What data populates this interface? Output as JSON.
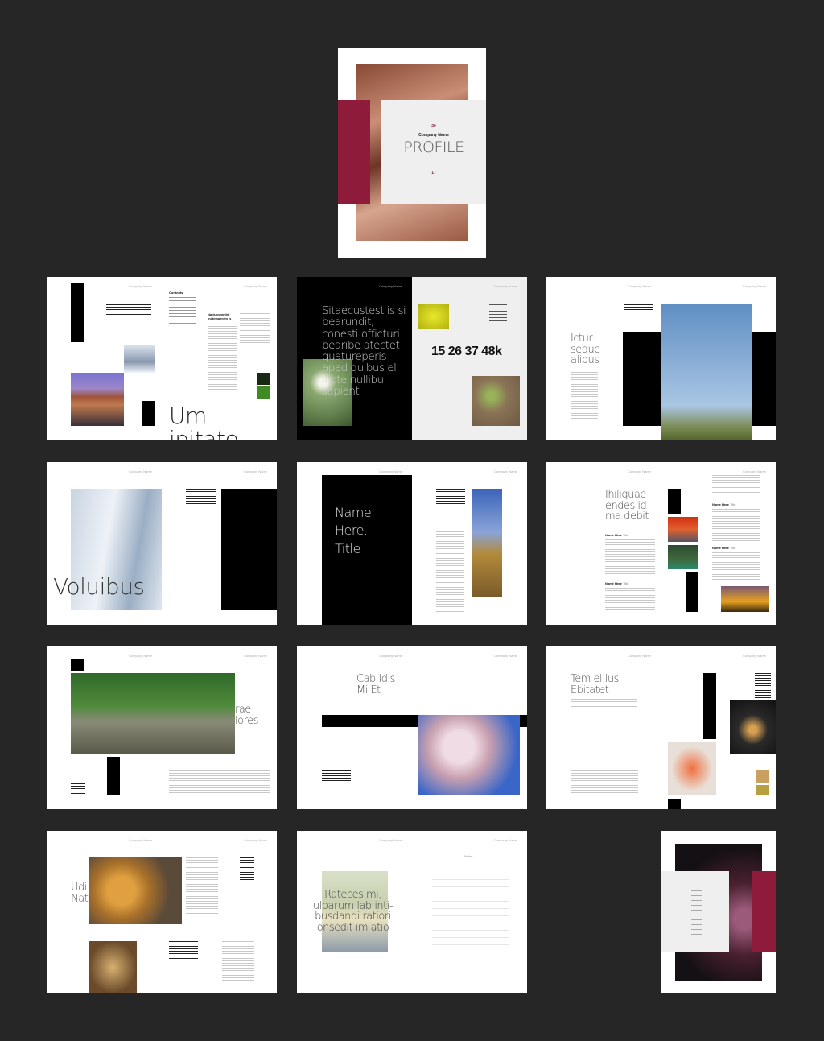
{
  "colors": {
    "background": "#262626",
    "accent": "#8e1b3a",
    "panel": "#efefef"
  },
  "header": "Company Name",
  "cover": {
    "year_top": "20",
    "company": "Company Name",
    "title": "PROFILE",
    "year_bottom": "17"
  },
  "spread1": {
    "contents": "Contents",
    "subtitle": "Natis comnihil inctemperem is",
    "display": "Um ipitate"
  },
  "spread2": {
    "quote": "Sitaecustest is si bearundit, conesti officturi bearibe atectet quatureperis aped quibus el incte nullibu sapient",
    "stats": "15 26 37 48k"
  },
  "spread3": {
    "display": "Ictur seque alibus"
  },
  "spread4": {
    "display": "Voluibus"
  },
  "spread5": {
    "display": "Name Here. Title"
  },
  "spread6": {
    "display": "Ihiliquae endes id ma debit",
    "name1": "Name Here",
    "title1": "Title",
    "name2": "Name Here",
    "title2": "Title",
    "name3": "Name Here",
    "title3": "Title",
    "name4": "Name Here",
    "title4": "Title"
  },
  "spread7": {
    "display": "rae lores"
  },
  "spread8": {
    "display": "Cab Idis Mi Et"
  },
  "spread9": {
    "display": "Tem el lus Ebitatet"
  },
  "spread10": {
    "display": "Udi Nati"
  },
  "spread11": {
    "display": "Rateces mi, ulparum lab inti-busdandi ratiori onsedit im atio",
    "notes": "Notes"
  }
}
